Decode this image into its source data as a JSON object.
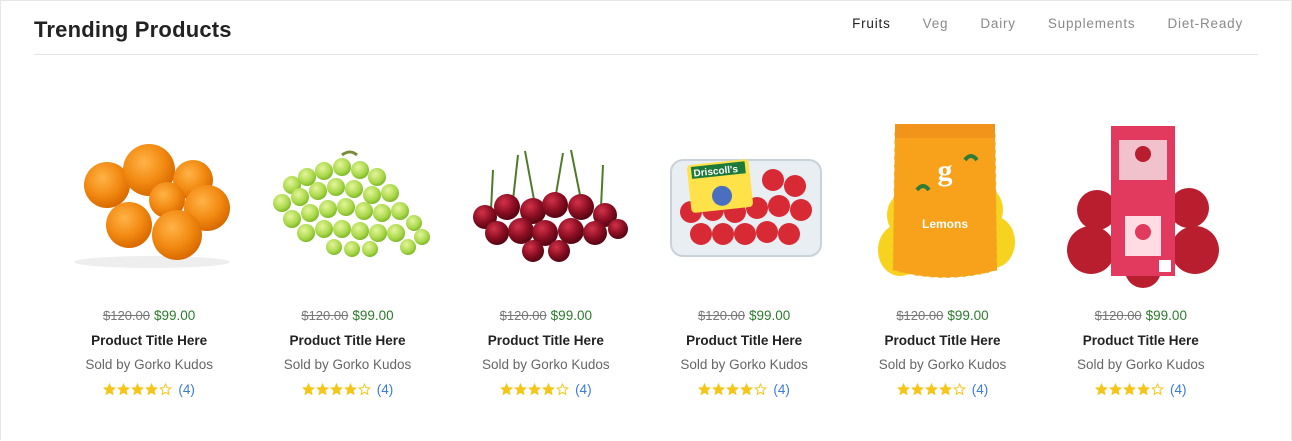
{
  "section": {
    "title": "Trending Products",
    "tabs": [
      "Fruits",
      "Veg",
      "Dairy",
      "Supplements",
      "Diet-Ready"
    ],
    "active_tab": "Fruits"
  },
  "colors": {
    "accent_price": "#2c7a2c",
    "rating_star": "#f5c518",
    "review_link": "#3a7bd5"
  },
  "products": [
    {
      "image": "oranges",
      "old_price": "$120.00",
      "price": "$99.00",
      "title": "Product Title Here",
      "seller": "Sold by Gorko Kudos",
      "rating": 4,
      "reviews": "(4)"
    },
    {
      "image": "green-grapes",
      "old_price": "$120.00",
      "price": "$99.00",
      "title": "Product Title Here",
      "seller": "Sold by Gorko Kudos",
      "rating": 4,
      "reviews": "(4)"
    },
    {
      "image": "cherries",
      "old_price": "$120.00",
      "price": "$99.00",
      "title": "Product Title Here",
      "seller": "Sold by Gorko Kudos",
      "rating": 4,
      "reviews": "(4)"
    },
    {
      "image": "raspberries-box",
      "brand_text": "Driscoll's",
      "old_price": "$120.00",
      "price": "$99.00",
      "title": "Product Title Here",
      "seller": "Sold by Gorko Kudos",
      "rating": 4,
      "reviews": "(4)"
    },
    {
      "image": "lemons-bag",
      "brand_text": "Lemons",
      "old_price": "$120.00",
      "price": "$99.00",
      "title": "Product Title Here",
      "seller": "Sold by Gorko Kudos",
      "rating": 4,
      "reviews": "(4)"
    },
    {
      "image": "apples-bag",
      "old_price": "$120.00",
      "price": "$99.00",
      "title": "Product Title Here",
      "seller": "Sold by Gorko Kudos",
      "rating": 4,
      "reviews": "(4)"
    }
  ]
}
